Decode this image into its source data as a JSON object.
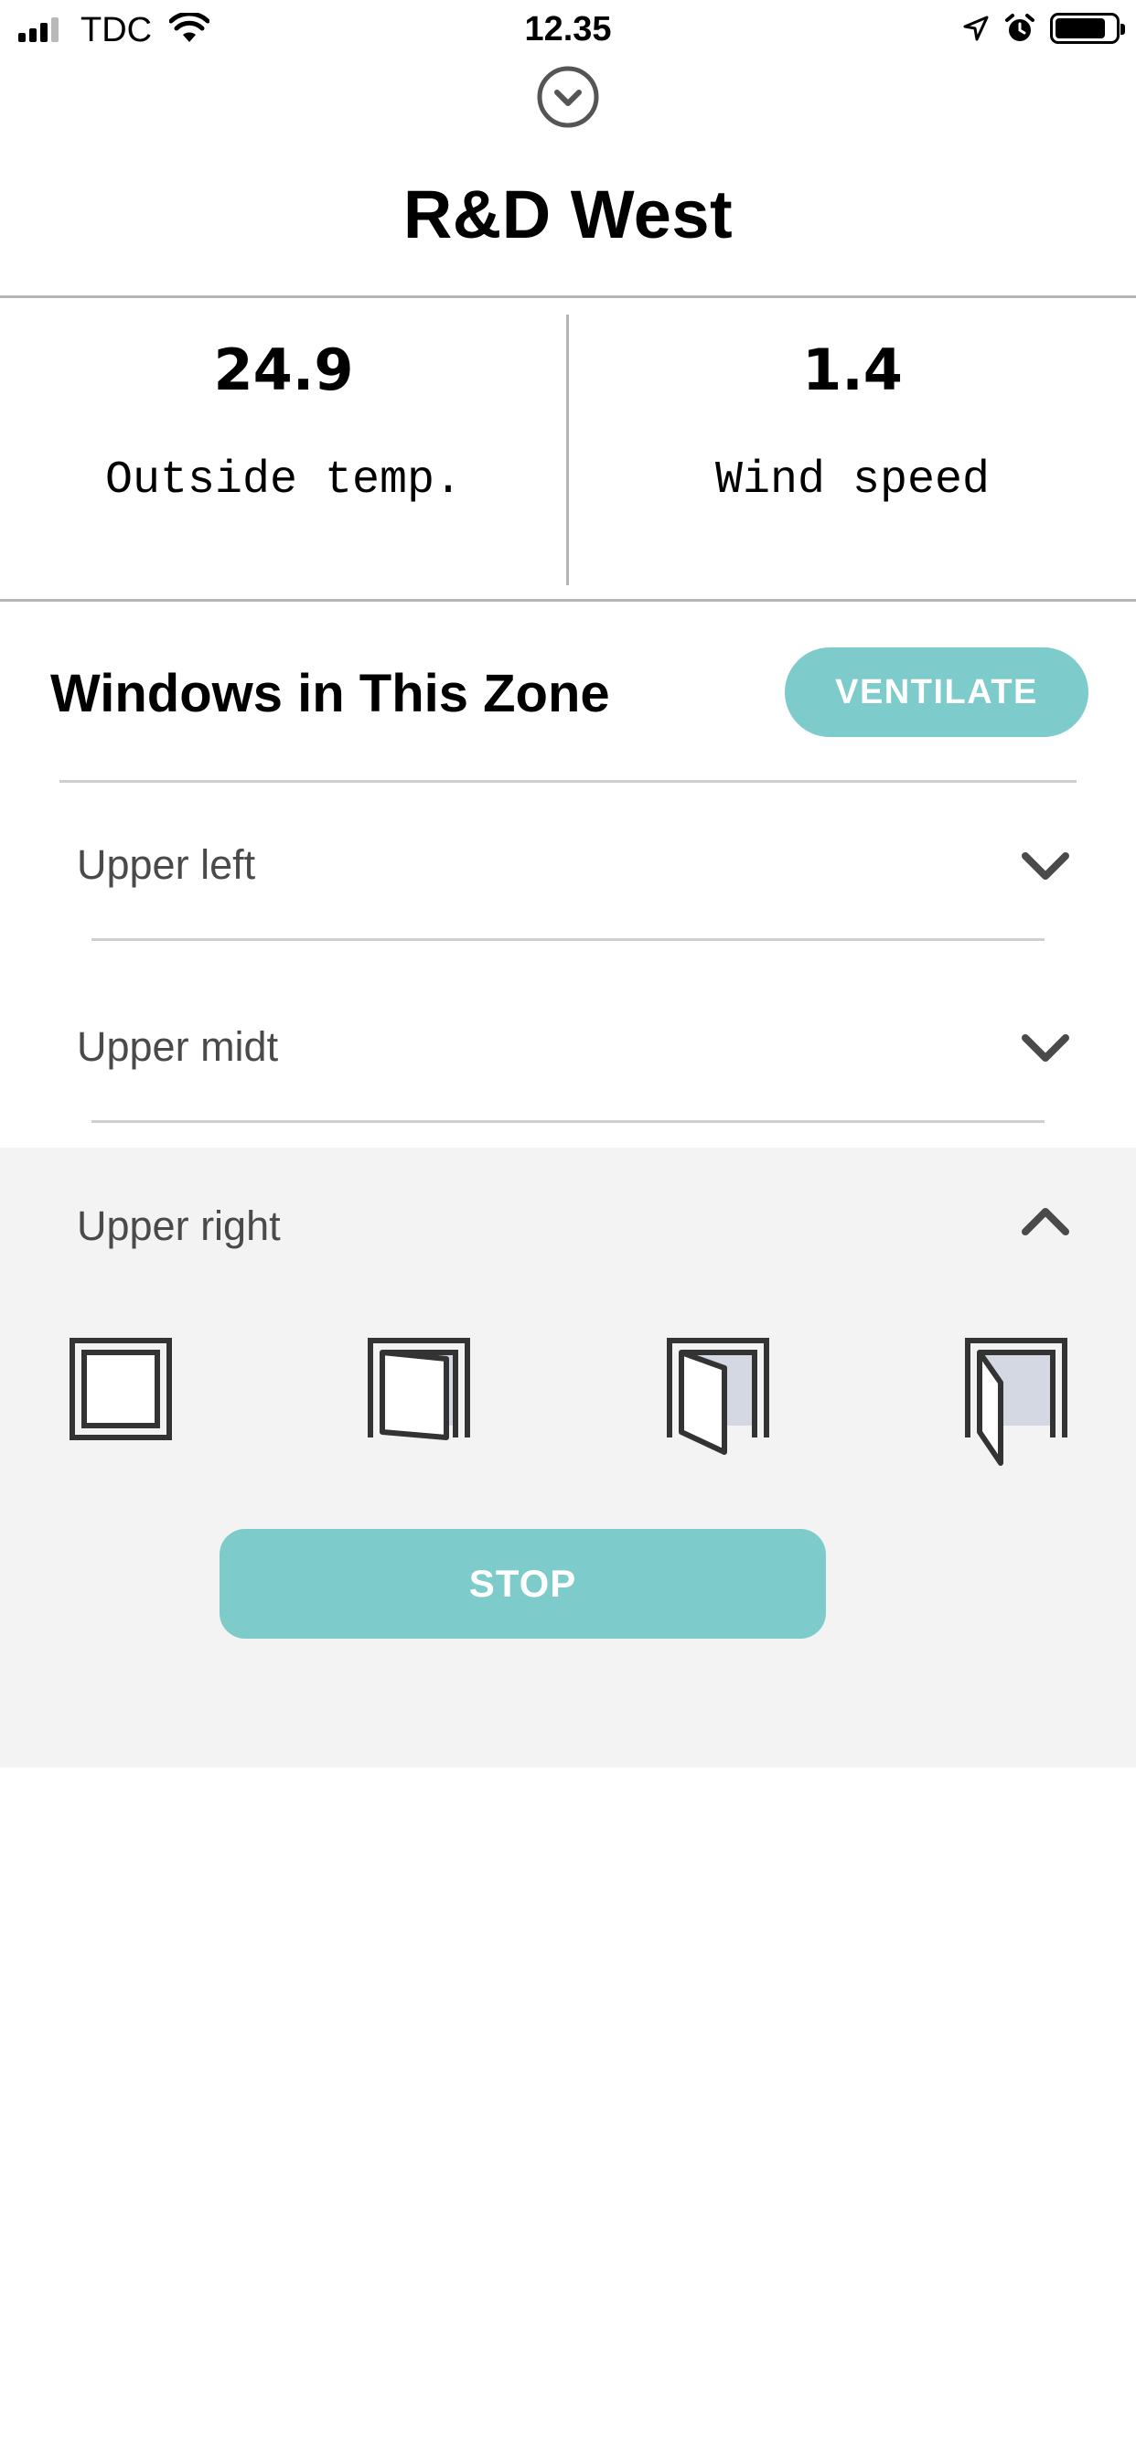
{
  "status_bar": {
    "carrier": "TDC",
    "time": "12.35",
    "battery_level": 0.85,
    "icons": [
      "signal-icon",
      "wifi-icon",
      "location-arrow-icon",
      "alarm-icon",
      "battery-icon"
    ]
  },
  "header": {
    "collapse_icon": "chevron-down-circle-icon",
    "title": "R&D West"
  },
  "stats": [
    {
      "value": "24.9",
      "label": "Outside temp."
    },
    {
      "value": "1.4",
      "label": "Wind speed"
    }
  ],
  "windows_section": {
    "title": "Windows in This Zone",
    "ventilate_label": "VENTILATE",
    "windows": [
      {
        "label": "Upper left",
        "expanded": false,
        "chevron_icon": "chevron-down-icon"
      },
      {
        "label": "Upper midt",
        "expanded": false,
        "chevron_icon": "chevron-down-icon"
      },
      {
        "label": "Upper right",
        "expanded": true,
        "chevron_icon": "chevron-up-icon"
      }
    ],
    "position_options": [
      "window-closed-icon",
      "window-slightly-open-icon",
      "window-half-open-icon",
      "window-fully-open-icon"
    ],
    "stop_label": "STOP"
  },
  "colors": {
    "accent": "#7ecbcb",
    "expanded_background": "#f3f3f3",
    "divider": "#b5b5b5",
    "window_pane": "#d3d8e3"
  }
}
